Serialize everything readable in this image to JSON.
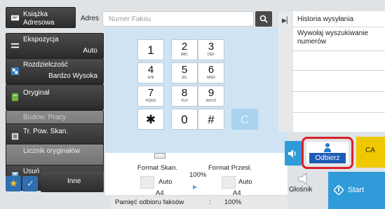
{
  "sidebar": {
    "address_book": {
      "line1": "Książka",
      "line2": "Adresowa"
    },
    "exposure": {
      "label": "Ekspozycja",
      "value": "Auto"
    },
    "resolution": {
      "label": "Rozdzielczość",
      "value": "Bardzo Wysoka"
    },
    "original": {
      "label": "Oryginał"
    },
    "job_build": {
      "label": "Budow. Pracy"
    },
    "tr_scan": {
      "label": "Tr. Pow. Skan."
    },
    "original_counter": {
      "label": "Licznik oryginałów"
    },
    "delete": {
      "label": "Usuń"
    },
    "other": {
      "label": "Inne"
    }
  },
  "address_bar": {
    "label": "Adres",
    "placeholder": "Numer Faksu"
  },
  "keypad": {
    "keys": [
      {
        "num": "1",
        "sub": ""
      },
      {
        "num": "2",
        "sub": "ABC"
      },
      {
        "num": "3",
        "sub": "DEF"
      },
      {
        "num": "4",
        "sub": "GHI"
      },
      {
        "num": "5",
        "sub": "JKL"
      },
      {
        "num": "6",
        "sub": "MNO"
      },
      {
        "num": "7",
        "sub": "PQRS"
      },
      {
        "num": "8",
        "sub": "TUV"
      },
      {
        "num": "9",
        "sub": "WXYZ"
      },
      {
        "num": "✱",
        "sub": ""
      },
      {
        "num": "0",
        "sub": ""
      },
      {
        "num": "#",
        "sub": ""
      },
      {
        "num": "C",
        "sub": ""
      }
    ]
  },
  "scan_info": {
    "format_scan_label": "Format Skan.",
    "format_send_label": "Format Przesł.",
    "zoom": "100%",
    "scan_mode": "Auto",
    "send_mode": "Auto",
    "scan_size": "A4",
    "send_size": "A4",
    "memory_label": "Pamięć odbioru faksów",
    "memory_sep": ":",
    "memory_value": "100%"
  },
  "right_panel": {
    "history_label": "Historia wysyłania",
    "recall_label": "Wywołaj wyszukiwanie numerów"
  },
  "buttons": {
    "receive_label": "Odbierz",
    "ca_label": "CA",
    "speaker_label": "Głośnik",
    "start_label": "Start"
  },
  "colors": {
    "accent_blue": "#2f9bd8",
    "receive_blue": "#1e5bb6",
    "highlight_red": "#d8202c",
    "ca_yellow": "#f0c800",
    "keypad_bg": "#cfe3f3"
  },
  "icons": {
    "search": "search-icon",
    "expand": "expand-arrow-icon",
    "star": "star-icon",
    "check": "checkmark-icon",
    "receive": "person-icon",
    "speaker": "speaker-icon",
    "volume": "volume-icon",
    "start": "start-diamond-icon"
  }
}
